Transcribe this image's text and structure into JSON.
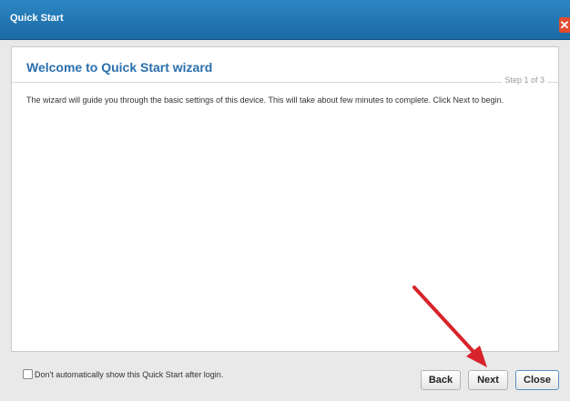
{
  "window": {
    "title": "Quick Start",
    "close_glyph": "✕"
  },
  "wizard": {
    "heading": "Welcome to Quick Start wizard",
    "step_text": "Step 1 of 3",
    "description": "The wizard will guide you through the basic settings of this device. This will take about few minutes to complete. Click Next to begin."
  },
  "footer": {
    "checkbox_label": "Don't automatically show this Quick Start after login.",
    "checkbox_checked": false,
    "back_label": "Back",
    "next_label": "Next",
    "close_label": "Close"
  },
  "annotation": {
    "arrow_color": "#d8232a",
    "arrow_icon": "red-pointer-arrow"
  },
  "colors": {
    "titlebar": "#1f74b1",
    "heading": "#2a6fad",
    "background": "#e9e9e9"
  }
}
